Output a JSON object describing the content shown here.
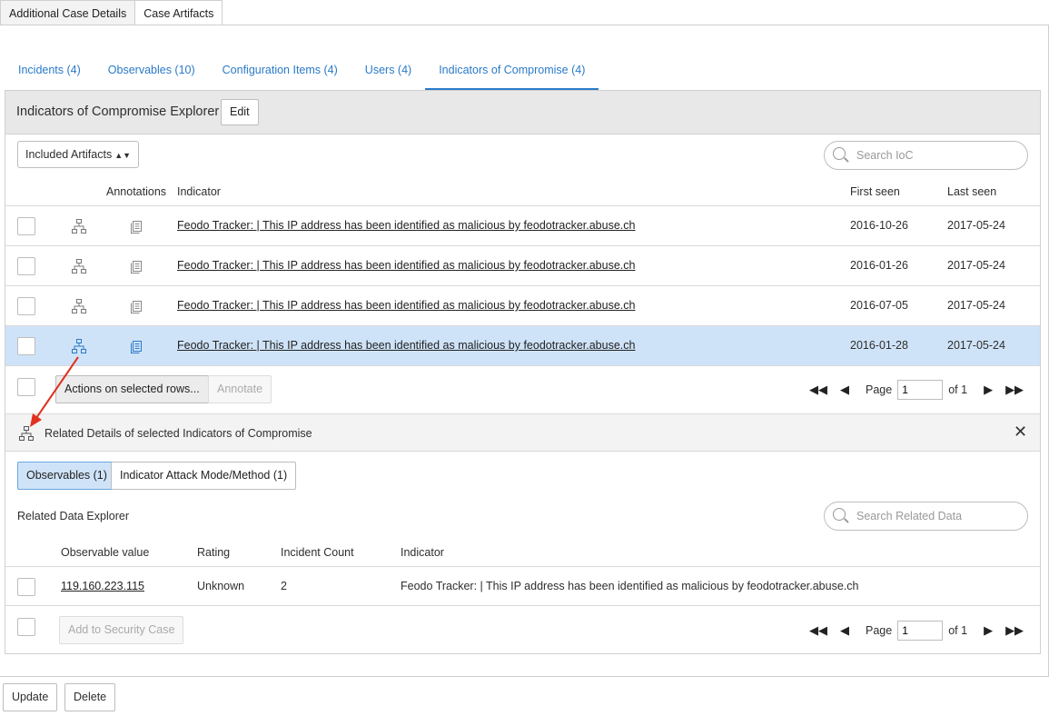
{
  "top_tabs": [
    {
      "label": "Additional Case Details",
      "active": false
    },
    {
      "label": "Case Artifacts",
      "active": true
    }
  ],
  "artifact_tabs": [
    {
      "label": "Incidents (4)"
    },
    {
      "label": "Observables (10)"
    },
    {
      "label": "Configuration Items (4)"
    },
    {
      "label": "Users (4)"
    },
    {
      "label": "Indicators of Compromise (4)",
      "active": true
    }
  ],
  "explorer": {
    "title": "Indicators of Compromise Explorer",
    "edit_label": "Edit",
    "filter_value": "Included Artifacts",
    "search_placeholder": "Search IoC",
    "columns": {
      "annotations": "Annotations",
      "indicator": "Indicator",
      "first_seen": "First seen",
      "last_seen": "Last seen"
    },
    "rows": [
      {
        "indicator": "Feodo Tracker: | This IP address has been identified as malicious by feodotracker.abuse.ch",
        "first_seen": "2016-10-26",
        "last_seen": "2017-05-24",
        "selected": false
      },
      {
        "indicator": "Feodo Tracker: | This IP address has been identified as malicious by feodotracker.abuse.ch",
        "first_seen": "2016-01-26",
        "last_seen": "2017-05-24",
        "selected": false
      },
      {
        "indicator": "Feodo Tracker: | This IP address has been identified as malicious by feodotracker.abuse.ch",
        "first_seen": "2016-07-05",
        "last_seen": "2017-05-24",
        "selected": false
      },
      {
        "indicator": "Feodo Tracker: | This IP address has been identified as malicious by feodotracker.abuse.ch",
        "first_seen": "2016-01-28",
        "last_seen": "2017-05-24",
        "selected": true
      }
    ],
    "actions_label": "Actions on selected rows...",
    "annotate_label": "Annotate",
    "pager": {
      "page_label": "Page",
      "page": "1",
      "of_label": "of 1"
    }
  },
  "related": {
    "title": "Related Details of selected Indicators of Compromise",
    "close": "✕",
    "tabs": [
      {
        "label": "Observables (1)",
        "active": true
      },
      {
        "label": "Indicator Attack Mode/Method (1)",
        "active": false
      }
    ],
    "explorer_title": "Related Data Explorer",
    "search_placeholder": "Search Related Data",
    "columns": {
      "observable_value": "Observable value",
      "rating": "Rating",
      "incident_count": "Incident Count",
      "indicator": "Indicator"
    },
    "rows": [
      {
        "observable_value": "119.160.223.115",
        "rating": "Unknown",
        "incident_count": "2",
        "indicator": "Feodo Tracker: | This IP address has been identified as malicious by feodotracker.abuse.ch"
      }
    ],
    "add_label": "Add to Security Case",
    "pager": {
      "page_label": "Page",
      "page": "1",
      "of_label": "of 1"
    }
  },
  "footer": {
    "update_label": "Update",
    "delete_label": "Delete"
  },
  "colors": {
    "accent": "#2a7ac8",
    "selected_row": "#cfe3f8",
    "arrow": "#e0321e"
  },
  "icons": {
    "hierarchy": "hierarchy-icon",
    "annotation": "annotation-icon",
    "search": "search-icon",
    "close": "close-icon"
  }
}
